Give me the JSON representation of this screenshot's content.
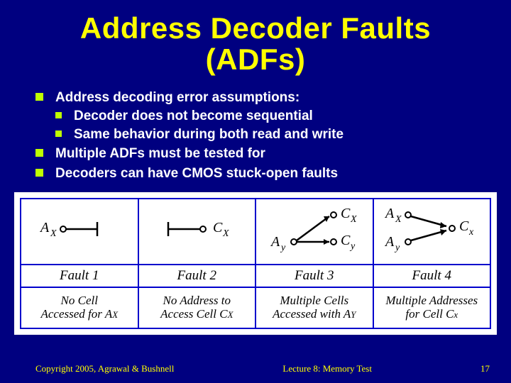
{
  "title_line1": "Address Decoder Faults",
  "title_line2": "(ADFs)",
  "bullets": {
    "b1": "Address decoding error  assumptions:",
    "b1a": "Decoder does not become sequential",
    "b1b": "Same behavior during both read and write",
    "b2": "Multiple ADFs must be tested for",
    "b3": "Decoders can have CMOS stuck-open faults"
  },
  "faults": {
    "f1": {
      "label": "Fault 1",
      "desc1": "No  Cell",
      "desc2": "Accessed for A",
      "sub": "X"
    },
    "f2": {
      "label": "Fault 2",
      "desc1": "No  Address to",
      "desc2": "Access Cell C",
      "sub": "X"
    },
    "f3": {
      "label": "Fault 3",
      "desc1": "Multiple  Cells",
      "desc2": "Accessed with A",
      "sub": "Y"
    },
    "f4": {
      "label": "Fault 4",
      "desc1": "Multiple Addresses",
      "desc2": "for  Cell  C",
      "sub": "x"
    }
  },
  "footer": {
    "left": "Copyright 2005, Agrawal & Bushnell",
    "center": "Lecture 8: Memory Test",
    "right": "17"
  }
}
